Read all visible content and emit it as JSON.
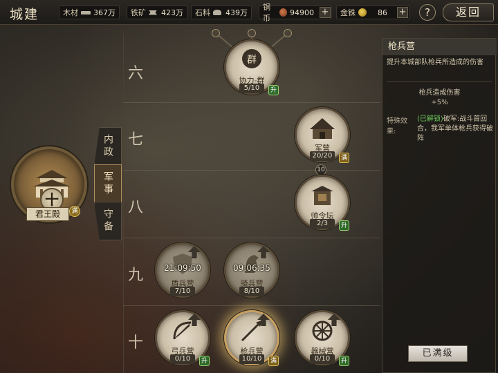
{
  "header": {
    "title": "城建",
    "resources": [
      {
        "label": "木材",
        "icon": "wood-icon",
        "value": "367万"
      },
      {
        "label": "铁矿",
        "icon": "iron-icon",
        "value": "423万"
      },
      {
        "label": "石料",
        "icon": "stone-icon",
        "value": "439万"
      },
      {
        "label": "铜币",
        "icon": "copper-coin-icon",
        "value": "94900"
      },
      {
        "label": "金铢",
        "icon": "gold-coin-icon",
        "value": "86"
      }
    ],
    "help_label": "?",
    "back_label": "返回"
  },
  "sidebar": {
    "king": {
      "rank": "十",
      "label": "君王殿",
      "badge": "满"
    },
    "tabs": [
      {
        "label": "内政",
        "selected": false
      },
      {
        "label": "军事",
        "selected": true
      },
      {
        "label": "守备",
        "selected": false
      }
    ]
  },
  "tree": {
    "tiers": [
      "六",
      "七",
      "八",
      "九",
      "十"
    ],
    "dependency_label": "10",
    "nodes": {
      "xieli": {
        "name": "协力-群",
        "level": "5/10",
        "badge": "升",
        "icon_text": "群"
      },
      "junying": {
        "name": "军营",
        "level": "20/20",
        "badge": "满"
      },
      "shuailingtan": {
        "name": "帅令坛",
        "level": "2/3",
        "badge": "升"
      },
      "dunbing": {
        "name": "盾兵营",
        "level": "7/10",
        "timer": "21:09:50"
      },
      "qibing": {
        "name": "骑兵营",
        "level": "8/10",
        "timer": "09:06:35"
      },
      "gongbing": {
        "name": "弓兵营",
        "level": "0/10",
        "badge": "升"
      },
      "qiangbing": {
        "name": "枪兵营",
        "level": "10/10",
        "badge": "满"
      },
      "qixie": {
        "name": "器械营",
        "level": "0/10",
        "badge": "升"
      }
    }
  },
  "info": {
    "title": "枪兵营",
    "description": "提升本城部队枪兵所造成的伤害",
    "effect_name": "枪兵造成伤害",
    "effect_value": "+5%",
    "special_label": "特殊效果:",
    "special_unlocked": "(已解锁)",
    "special_text": "破军:战斗首回合，我军单体枪兵获得破阵",
    "max_button": "已满级"
  },
  "colors": {
    "upgrade_badge": "#2f6a2a",
    "max_badge": "#7a5e18",
    "unlocked_text": "#6ac85a"
  }
}
